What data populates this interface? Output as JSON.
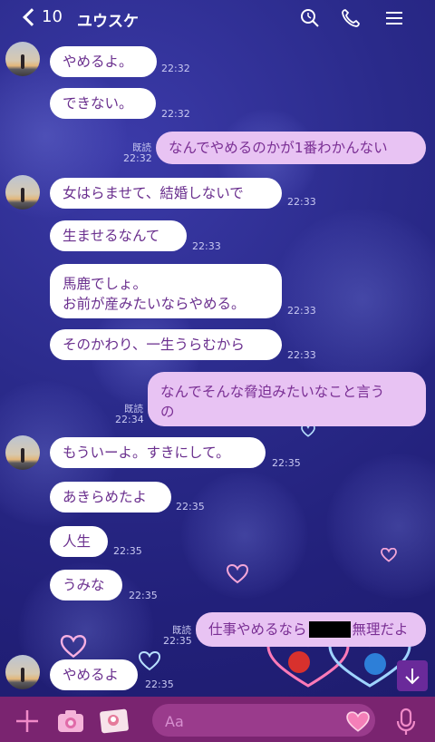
{
  "header": {
    "back_count": "10",
    "title": "ユウスケ"
  },
  "icons": {
    "back": "chevron-left-icon",
    "search": "search-icon",
    "call": "phone-icon",
    "menu": "hamburger-menu-icon",
    "add": "plus-icon",
    "camera": "camera-icon",
    "photo": "photo-icon",
    "emoji": "heart-emoji-icon",
    "mic": "microphone-icon",
    "scroll": "arrow-down-icon"
  },
  "colors": {
    "background": "#2a2a8a",
    "incoming_bubble": "#ffffff",
    "outgoing_bubble": "#e8c3f3",
    "text": "#6a2f8e",
    "footer": "#7a2470"
  },
  "messages": [
    {
      "dir": "in",
      "text": "やめるよ。",
      "time": "22:32"
    },
    {
      "dir": "in",
      "text": "できない。",
      "time": "22:32"
    },
    {
      "dir": "out",
      "text": "なんでやめるのかが1番わかんない",
      "time": "22:32",
      "read": "既読"
    },
    {
      "dir": "in",
      "text": "女はらませて、結婚しないで",
      "time": "22:33"
    },
    {
      "dir": "in",
      "text": "生ませるなんて",
      "time": "22:33"
    },
    {
      "dir": "in",
      "lines": [
        "馬鹿でしょ。",
        "お前が産みたいならやめる。"
      ],
      "time": "22:33"
    },
    {
      "dir": "in",
      "text": "そのかわり、一生うらむから",
      "time": "22:33"
    },
    {
      "dir": "out",
      "lines": [
        "なんでそんな脅迫みたいなこと言う",
        "の"
      ],
      "time": "22:34",
      "read": "既読"
    },
    {
      "dir": "in",
      "text": "もういーよ。すきにして。",
      "time": "22:35"
    },
    {
      "dir": "in",
      "text": "あきらめたよ",
      "time": "22:35"
    },
    {
      "dir": "in",
      "text": "人生",
      "time": "22:35"
    },
    {
      "dir": "in",
      "text": "うみな",
      "time": "22:35"
    },
    {
      "dir": "out",
      "text_before": "仕事やめるなら",
      "text_after": "無理だよ",
      "time": "22:35",
      "read": "既読"
    },
    {
      "dir": "in",
      "text": "やめるよ",
      "time": "22:35"
    }
  ],
  "input": {
    "placeholder": "Aa"
  }
}
